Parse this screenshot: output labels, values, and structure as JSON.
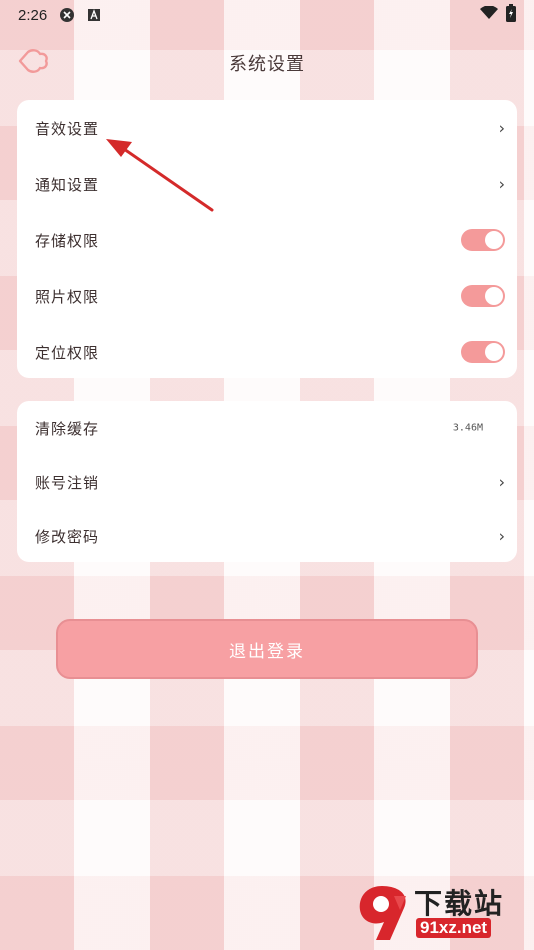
{
  "status_bar": {
    "time": "2:26"
  },
  "header": {
    "title": "系统设置"
  },
  "permissions_card": {
    "items": [
      {
        "label": "音效设置",
        "control": "chevron"
      },
      {
        "label": "通知设置",
        "control": "chevron"
      },
      {
        "label": "存储权限",
        "control": "toggle",
        "on": true
      },
      {
        "label": "照片权限",
        "control": "toggle",
        "on": true
      },
      {
        "label": "定位权限",
        "control": "toggle",
        "on": true
      }
    ]
  },
  "account_card": {
    "items": [
      {
        "label": "清除缓存",
        "value": "3.46M"
      },
      {
        "label": "账号注销",
        "control": "chevron"
      },
      {
        "label": "修改密码",
        "control": "chevron"
      }
    ]
  },
  "chevron_glyph": "›",
  "logout_button": {
    "label": "退出登录"
  },
  "watermark": {
    "brand": "下载站",
    "domain": "91xz.net"
  },
  "colors": {
    "accent_pink": "#f49a9a",
    "button_pink": "#f7a0a3",
    "annotation_red": "#d42a2a"
  },
  "icons": [
    "back-cloud-icon",
    "wifi-icon",
    "battery-icon",
    "chevron-right-icon",
    "toggle-switch"
  ]
}
